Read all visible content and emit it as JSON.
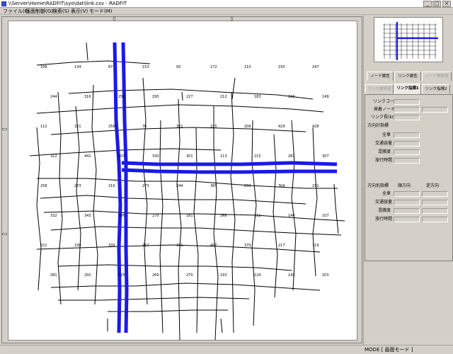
{
  "window": {
    "title": "\\\\Server\\Home\\RADFIT\\syo\\dat\\link.csv - RADFIT",
    "min_glyph": "_",
    "max_glyph": "□",
    "close_glyph": "×"
  },
  "menu": {
    "items": [
      {
        "label": "ファイル(F)"
      },
      {
        "label": "画面制御(G)"
      },
      {
        "label": "検索(S)"
      },
      {
        "label": "表示(V)"
      },
      {
        "label": "モード(M)"
      }
    ]
  },
  "colors": {
    "highlight": "#1a1ae6",
    "road": "#000000",
    "background": "#d4d0c8",
    "canvas": "#ffffff"
  },
  "map": {
    "link_labels": [
      "108",
      "134",
      "87",
      "153",
      "93",
      "172",
      "210",
      "150",
      "247",
      "244",
      "316",
      "259",
      "295",
      "227",
      "212",
      "183",
      "156",
      "149",
      "112",
      "321",
      "256",
      "76",
      "301",
      "225",
      "206",
      "429",
      "428",
      "312",
      "441",
      "403",
      "330",
      "301",
      "113",
      "215",
      "281",
      "307",
      "258",
      "273",
      "210",
      "273",
      "244",
      "365",
      "233",
      "304",
      "211",
      "332",
      "343",
      "306",
      "270",
      "181",
      "268",
      "111",
      "144",
      "107",
      "221",
      "230",
      "339",
      "257",
      "311",
      "402",
      "370",
      "217",
      "119",
      "281",
      "292",
      "225",
      "269",
      "270",
      "193",
      "124",
      "143",
      "203"
    ]
  },
  "tabs": {
    "row1": [
      {
        "label": "ノード属性",
        "state": "normal"
      },
      {
        "label": "リンク属性",
        "state": "normal"
      },
      {
        "label": "ノード検索値",
        "state": "disabled"
      }
    ],
    "row2": [
      {
        "label": "リンク検索値",
        "state": "disabled"
      },
      {
        "label": "リンク指標1",
        "state": "active"
      },
      {
        "label": "リンク指標2",
        "state": "normal"
      }
    ]
  },
  "link_panel": {
    "link_code": "リンクコード",
    "origin_node": "発着ノード",
    "link_length": "リンク長(km)",
    "direction_total": "方向計指標",
    "all_vehicles": "全車",
    "traffic_volume": "交通容量",
    "congestion": "混雑度",
    "travel_time": "旅行時間"
  },
  "direction_panel": {
    "header": "方向別指標",
    "forward": "順方向",
    "reverse": "逆方向",
    "all_vehicles": "全車",
    "traffic_volume": "交通容量",
    "congestion": "混雑度",
    "travel_time": "旅行時間"
  },
  "status": {
    "mode_text": "MODE [ 画面モード ]"
  }
}
